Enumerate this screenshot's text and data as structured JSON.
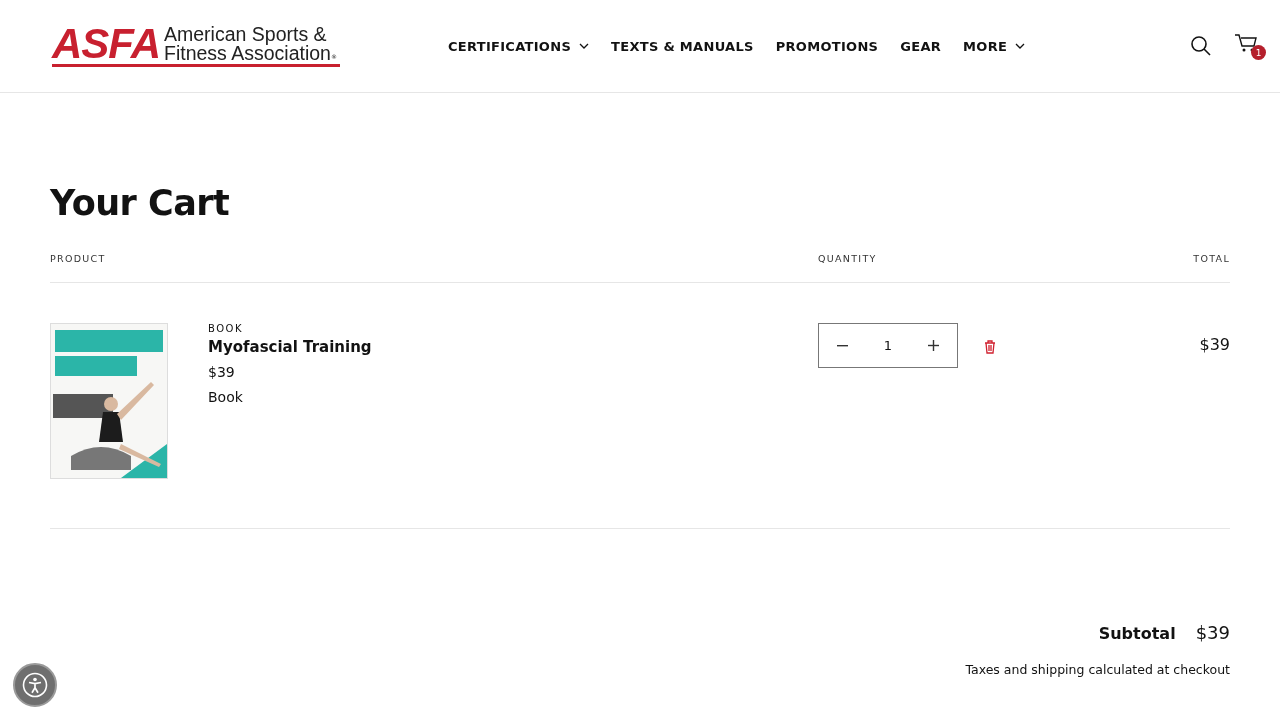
{
  "header": {
    "logo": {
      "mark": "ASFA",
      "name_lines": [
        "American Sports &",
        "Fitness Association"
      ],
      "registered": "®"
    },
    "nav": [
      {
        "label": "CERTIFICATIONS",
        "dropdown": true
      },
      {
        "label": "TEXTS & MANUALS",
        "dropdown": false
      },
      {
        "label": "PROMOTIONS",
        "dropdown": false
      },
      {
        "label": "GEAR",
        "dropdown": false
      },
      {
        "label": "MORE",
        "dropdown": true
      }
    ],
    "cart_count": "1"
  },
  "title": "Your Cart",
  "columns": [
    "PRODUCT",
    "QUANTITY",
    "TOTAL"
  ],
  "items": [
    {
      "category": "BOOK",
      "name": "Myofascial Training",
      "price": "$39",
      "variant": "Book",
      "quantity": "1",
      "total": "$39"
    }
  ],
  "summary": {
    "label": "Subtotal",
    "value": "$39",
    "note": "Taxes and shipping calculated at checkout"
  }
}
